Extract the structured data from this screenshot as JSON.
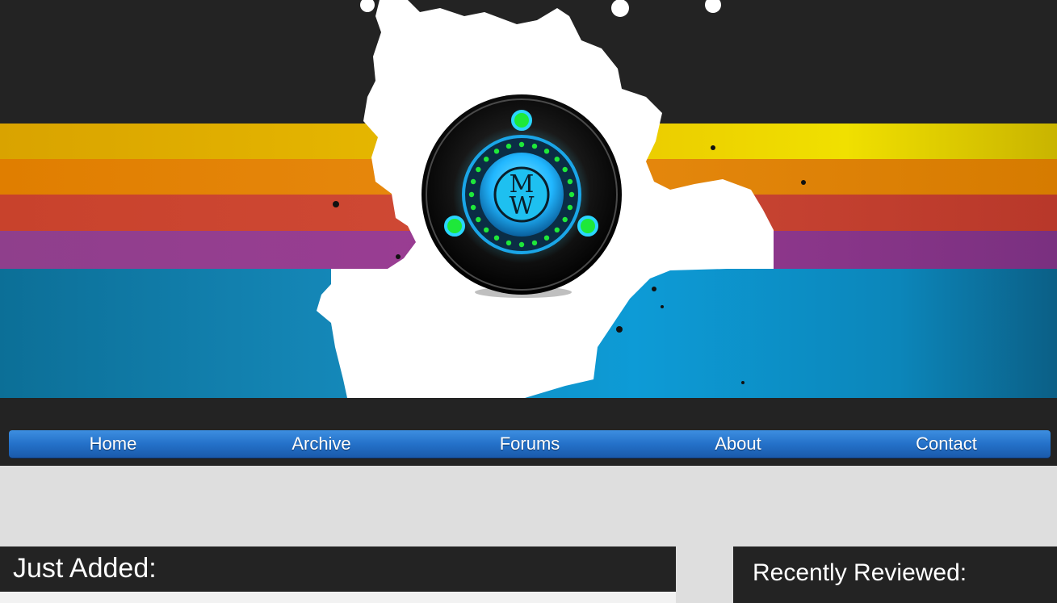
{
  "banner": {
    "logo_letters": "MW",
    "logo_top": "M",
    "logo_bottom": "W",
    "colors": {
      "background": "#232323",
      "yellow": "#e6b800",
      "orange": "#e88a10",
      "red": "#d04a36",
      "purple": "#9c3c94",
      "cyan": "#0d9bd6",
      "logo_glow": "#21b7ff",
      "logo_dots": "#1ee83a"
    }
  },
  "nav": {
    "items": [
      {
        "label": "Home"
      },
      {
        "label": "Archive"
      },
      {
        "label": "Forums"
      },
      {
        "label": "About"
      },
      {
        "label": "Contact"
      }
    ],
    "color": "#2471c9"
  },
  "sections": {
    "just_added": {
      "title": "Just Added:"
    },
    "recently_reviewed": {
      "title": "Recently Reviewed:"
    }
  }
}
